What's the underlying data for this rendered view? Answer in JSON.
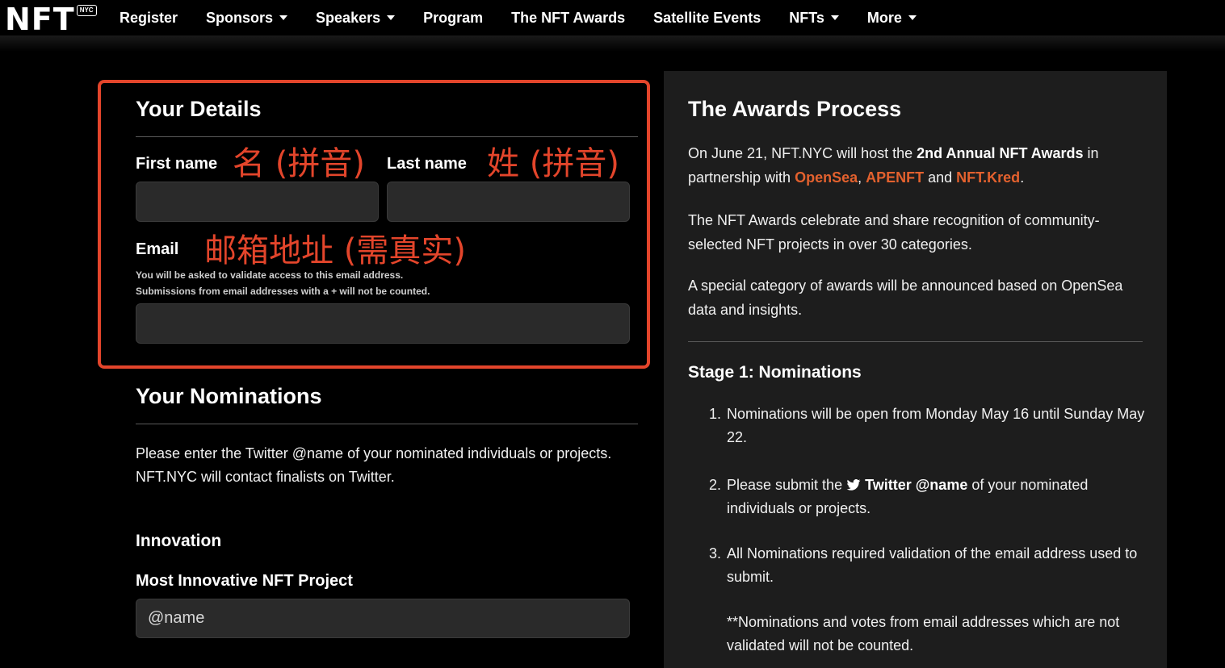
{
  "nav": {
    "logo": "NFT",
    "logo_badge": "NYC",
    "items": [
      {
        "label": "Register",
        "dropdown": false
      },
      {
        "label": "Sponsors",
        "dropdown": true
      },
      {
        "label": "Speakers",
        "dropdown": true
      },
      {
        "label": "Program",
        "dropdown": false
      },
      {
        "label": "The NFT Awards",
        "dropdown": false
      },
      {
        "label": "Satellite Events",
        "dropdown": false
      },
      {
        "label": "NFTs",
        "dropdown": true
      },
      {
        "label": "More",
        "dropdown": true
      }
    ]
  },
  "details": {
    "title": "Your Details",
    "first_name_label": "First name",
    "first_name_annotation": "名 (拼音)",
    "first_name_value": "",
    "last_name_label": "Last name",
    "last_name_annotation": "姓 (拼音)",
    "last_name_value": "",
    "email_label": "Email",
    "email_annotation": "邮箱地址 (需真实)",
    "email_note_1": "You will be asked to validate access to this email address.",
    "email_note_2": "Submissions from email addresses with a + will not be counted.",
    "email_value": ""
  },
  "nominations": {
    "title": "Your Nominations",
    "intro_1": "Please enter the Twitter @name of your nominated individuals or projects.",
    "intro_2": "NFT.NYC will contact finalists on Twitter.",
    "category": "Innovation",
    "field_label": "Most Innovative NFT Project",
    "field_placeholder": "@name"
  },
  "awards": {
    "title": "The Awards Process",
    "p1_a": "On June 21, NFT.NYC will host the ",
    "p1_bold": "2nd Annual NFT Awards",
    "p1_b": " in partnership with ",
    "partner_1": "OpenSea",
    "p1_comma": ", ",
    "partner_2": "APENFT",
    "p1_and": " and ",
    "partner_3": "NFT.Kred",
    "p1_end": ".",
    "p2": "The NFT Awards celebrate and share recognition of community-selected NFT projects in over 30 categories.",
    "p3": "A special category of awards will be announced based on OpenSea data and insights.",
    "stage_title": "Stage 1: Nominations",
    "steps": [
      {
        "num": "1.",
        "text": "Nominations will be open from Monday May 16 until Sunday May 22."
      },
      {
        "num": "2.",
        "text_a": "Please submit the ",
        "bold": "Twitter @name",
        "text_b": " of your nominated individuals or projects."
      },
      {
        "num": "3.",
        "text": "All Nominations required validation of the email address used to submit."
      }
    ],
    "footnote": "**Nominations and votes from email addresses which are not validated will not be counted."
  },
  "colors": {
    "accent": "#e3452b",
    "link": "#e3612e",
    "panel_bg": "#1d1d1d",
    "input_bg": "#2a2a2a"
  }
}
